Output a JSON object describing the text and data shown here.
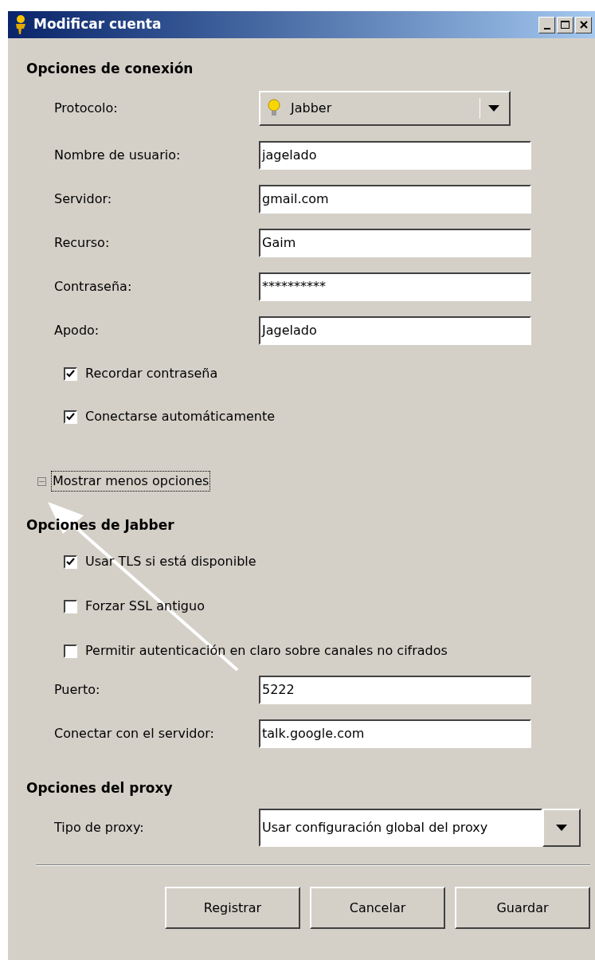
{
  "window": {
    "title": "Modificar cuenta"
  },
  "connection": {
    "heading": "Opciones de conexión",
    "protocol": {
      "label": "Protocolo:",
      "value": "Jabber"
    },
    "fields": [
      {
        "label": "Nombre de usuario:",
        "value": "jagelado"
      },
      {
        "label": "Servidor:",
        "value": "gmail.com"
      },
      {
        "label": "Recurso:",
        "value": "Gaim"
      },
      {
        "label": "Contraseña:",
        "value": "**********"
      },
      {
        "label": "Apodo:",
        "value": "Jagelado"
      }
    ],
    "checks": [
      {
        "label": "Recordar contraseña",
        "checked": true
      },
      {
        "label": "Conectarse automáticamente",
        "checked": true
      }
    ]
  },
  "toggle": {
    "label": "Mostrar menos opciones",
    "expanded": true
  },
  "jabber": {
    "heading": "Opciones de Jabber",
    "checks": [
      {
        "label": "Usar TLS si está disponible",
        "checked": true
      },
      {
        "label": "Forzar SSL antiguo",
        "checked": false
      },
      {
        "label": "Permitir autenticación en claro sobre canales no cifrados",
        "checked": false
      }
    ],
    "fields": [
      {
        "label": "Puerto:",
        "value": "5222"
      },
      {
        "label": "Conectar con el servidor:",
        "value": "talk.google.com"
      }
    ]
  },
  "proxy": {
    "heading": "Opciones del proxy",
    "label": "Tipo de proxy:",
    "value": "Usar configuración global del proxy"
  },
  "buttons": [
    "Registrar",
    "Cancelar",
    "Guardar"
  ]
}
